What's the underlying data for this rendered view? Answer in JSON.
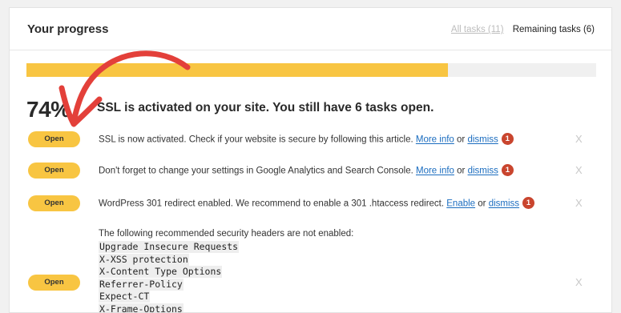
{
  "header": {
    "title": "Your progress",
    "tabs": [
      {
        "label": "All tasks (11)"
      },
      {
        "label": "Remaining tasks (6)"
      }
    ]
  },
  "progress": {
    "percent_label": "74%",
    "fraction": 0.74,
    "summary": "SSL is activated on your site. You still have 6 tasks open.",
    "fill_color": "#f8c542"
  },
  "tasks": [
    {
      "button": "Open",
      "text": "SSL is now activated. Check if your website is secure by following this article.",
      "link1": "More info",
      "joiner": "or",
      "link2": "dismiss",
      "badge": "1",
      "close": "X"
    },
    {
      "button": "Open",
      "text": "Don't forget to change your settings in Google Analytics and Search Console.",
      "link1": "More info",
      "joiner": "or",
      "link2": "dismiss",
      "badge": "1",
      "close": "X"
    },
    {
      "button": "Open",
      "text": "WordPress 301 redirect enabled. We recommend to enable a 301 .htaccess redirect.",
      "link1": "Enable",
      "joiner": "or",
      "link2": "dismiss",
      "badge": "1",
      "close": "X"
    },
    {
      "button": "Open",
      "intro": "The following recommended security headers are not enabled:",
      "headers": [
        "Upgrade Insecure Requests",
        "X-XSS protection",
        "X-Content Type Options",
        "Referrer-Policy",
        "Expect-CT",
        "X-Frame-Options"
      ],
      "close": "X"
    }
  ],
  "colors": {
    "accent": "#f8c542",
    "link": "#1a6cbf",
    "badge": "#c9452e",
    "annotation_arrow": "#e3403a"
  },
  "icons": {
    "annotation": "red-hand-drawn-arrow-icon",
    "close": "close-x-icon",
    "badge": "notification-count-badge"
  }
}
